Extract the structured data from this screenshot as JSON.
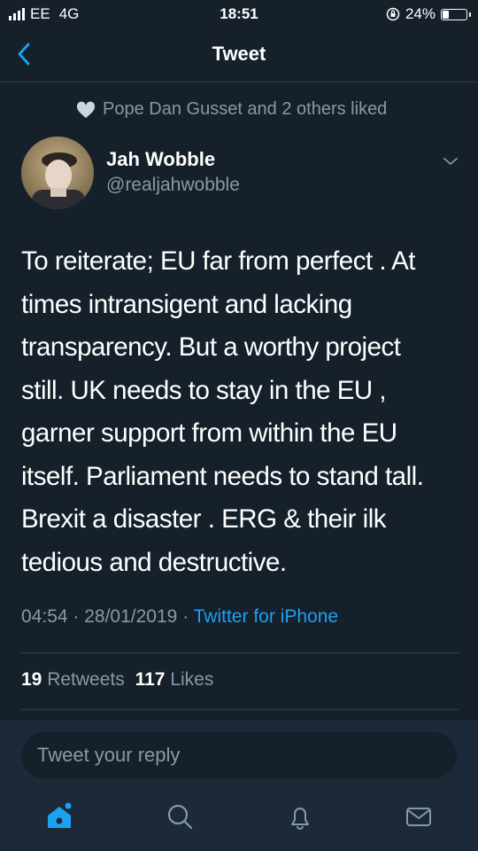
{
  "status_bar": {
    "carrier": "EE",
    "network": "4G",
    "time": "18:51",
    "battery_percent": "24%",
    "battery_level": 0.24
  },
  "nav": {
    "title": "Tweet",
    "back_icon": "chevron-left-icon"
  },
  "social_context": {
    "icon": "heart-icon",
    "text": "Pope Dan Gusset and 2 others liked"
  },
  "author": {
    "name": "Jah Wobble",
    "handle": "@realjahwobble"
  },
  "tweet": {
    "text": "To reiterate; EU far from perfect . At\ntimes intransigent and lacking\ntransparency. But a worthy project\nstill. UK needs to stay in the EU ,\ngarner support from within the EU\nitself. Parliament needs to stand tall.\nBrexit a disaster . ERG & their ilk\ntedious and destructive.",
    "time": "04:54",
    "date": "28/01/2019",
    "source": "Twitter for iPhone"
  },
  "stats": {
    "retweets": "19",
    "retweets_label": "Retweets",
    "likes": "117",
    "likes_label": "Likes"
  },
  "reply": {
    "placeholder": "Tweet your reply"
  },
  "tabbar": [
    "home-icon",
    "search-icon",
    "notifications-bell-icon",
    "messages-envelope-icon"
  ],
  "colors": {
    "background": "#15202b",
    "accent": "#1da1f2",
    "secondary_text": "#8899a6",
    "reply_bar": "#1c2938"
  }
}
